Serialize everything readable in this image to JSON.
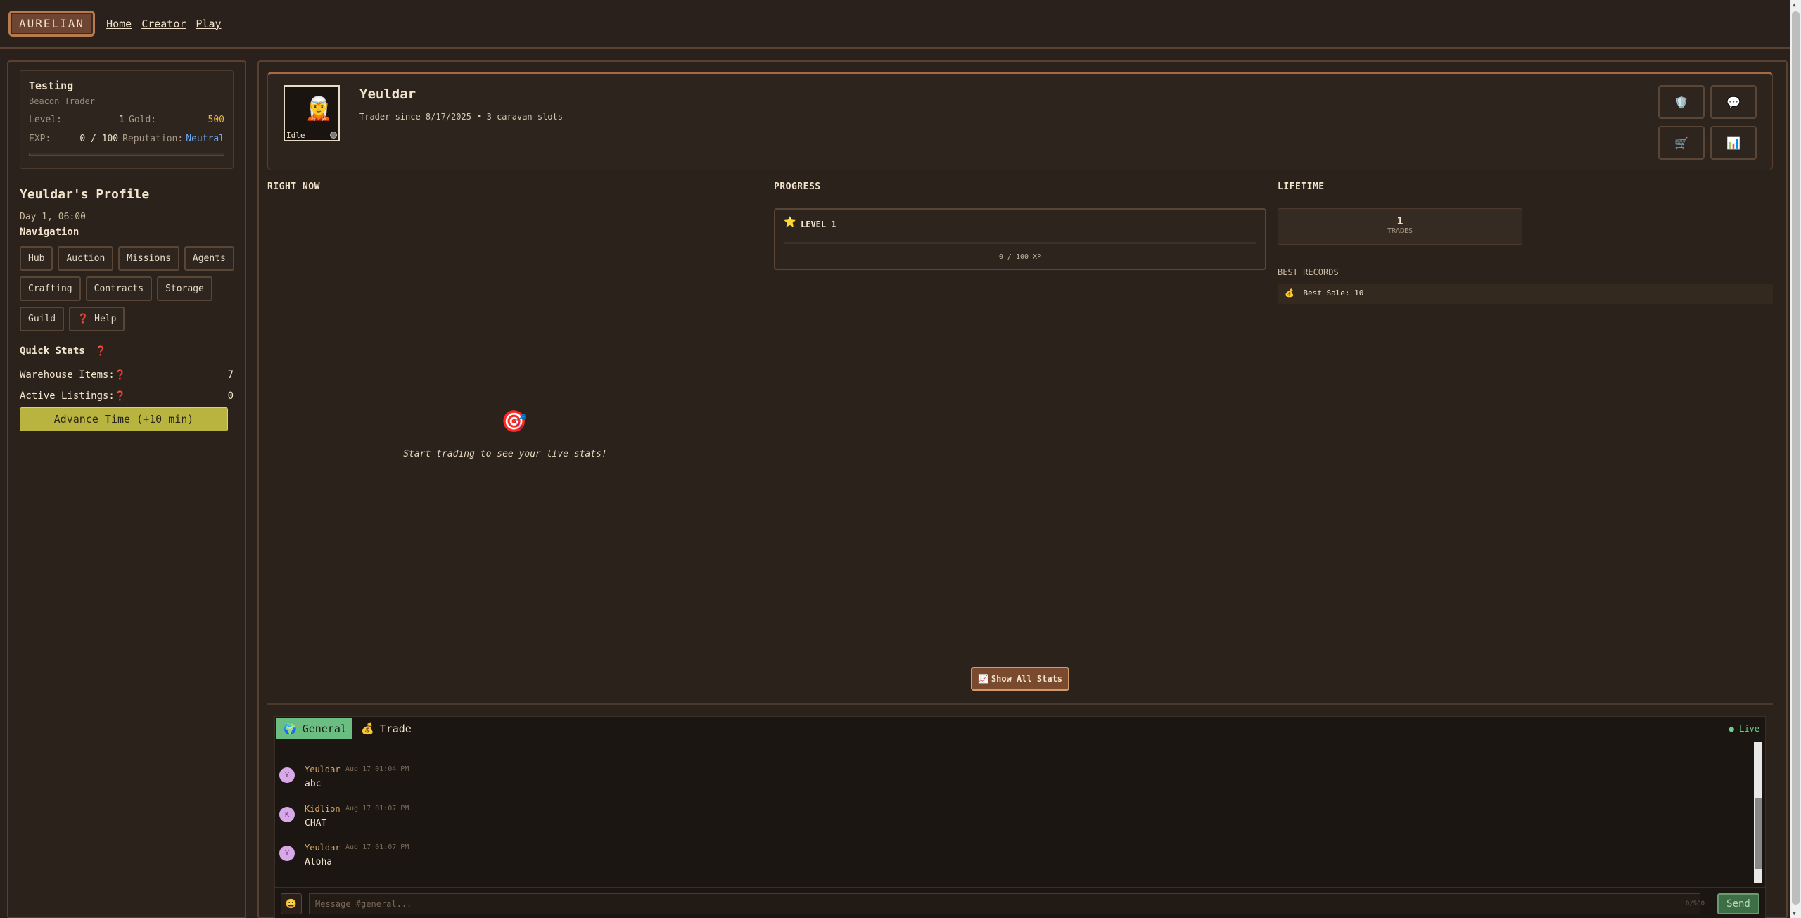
{
  "header": {
    "logo": "AURELIAN",
    "links": [
      "Home",
      "Creator",
      "Play"
    ]
  },
  "sidebar": {
    "user": {
      "name": "Testing",
      "title": "Beacon Trader",
      "level_label": "Level:",
      "level": "1",
      "gold_label": "Gold:",
      "gold": "500",
      "exp_label": "EXP:",
      "exp": "0 / 100",
      "rep_label": "Reputation:",
      "rep": "Neutral",
      "exp_progress": 0
    },
    "profile_title": "Yeuldar's Profile",
    "datetime": "Day 1, 06:00",
    "nav_title": "Navigation",
    "nav": [
      "Hub",
      "Auction",
      "Missions",
      "Agents",
      "Crafting",
      "Contracts",
      "Storage",
      "Guild"
    ],
    "help_label": "Help",
    "quick_stats_title": "Quick Stats",
    "warehouse_label": "Warehouse Items:",
    "warehouse_value": "7",
    "listings_label": "Active Listings:",
    "listings_value": "0",
    "advance_btn": "Advance Time (+10 min)"
  },
  "profile": {
    "name": "Yeuldar",
    "subtitle": "Trader since 8/17/2025 • 3 caravan slots",
    "status": "Idle",
    "avatar_icon": "character-sprite",
    "action_icons": [
      "shield-icon",
      "speech-bubble-icon",
      "cart-icon",
      "chart-icon"
    ]
  },
  "sections": {
    "right_now": "RIGHT NOW",
    "progress": "PROGRESS",
    "lifetime": "LIFETIME"
  },
  "right_now": {
    "empty_text": "Start trading to see your live stats!"
  },
  "progress": {
    "level_label": "LEVEL 1",
    "xp_text": "0 / 100 XP",
    "xp_fraction": 0
  },
  "lifetime": {
    "trades_value": "1",
    "trades_label": "TRADES",
    "best_records_title": "BEST RECORDS",
    "best_sale": "Best Sale: 10"
  },
  "show_all_btn": "Show All Stats",
  "chat": {
    "tabs": [
      "General",
      "Trade"
    ],
    "live": "Live",
    "messages": [
      {
        "initial": "Y",
        "user": "Yeuldar",
        "time": "Aug 17 01:04 PM",
        "text": "abc"
      },
      {
        "initial": "K",
        "user": "Kidlion",
        "time": "Aug 17 01:07 PM",
        "text": "CHAT"
      },
      {
        "initial": "Y",
        "user": "Yeuldar",
        "time": "Aug 17 01:07 PM",
        "text": "Aloha"
      }
    ],
    "placeholder": "Message #general...",
    "char_count": "0/500",
    "send": "Send"
  },
  "colors": {
    "gold": "#e5b43a",
    "reputation": "#6aa8f0",
    "general_tab": "#6abe82",
    "advance_btn": "#b9b440",
    "send_btn": "#3d6e45"
  }
}
